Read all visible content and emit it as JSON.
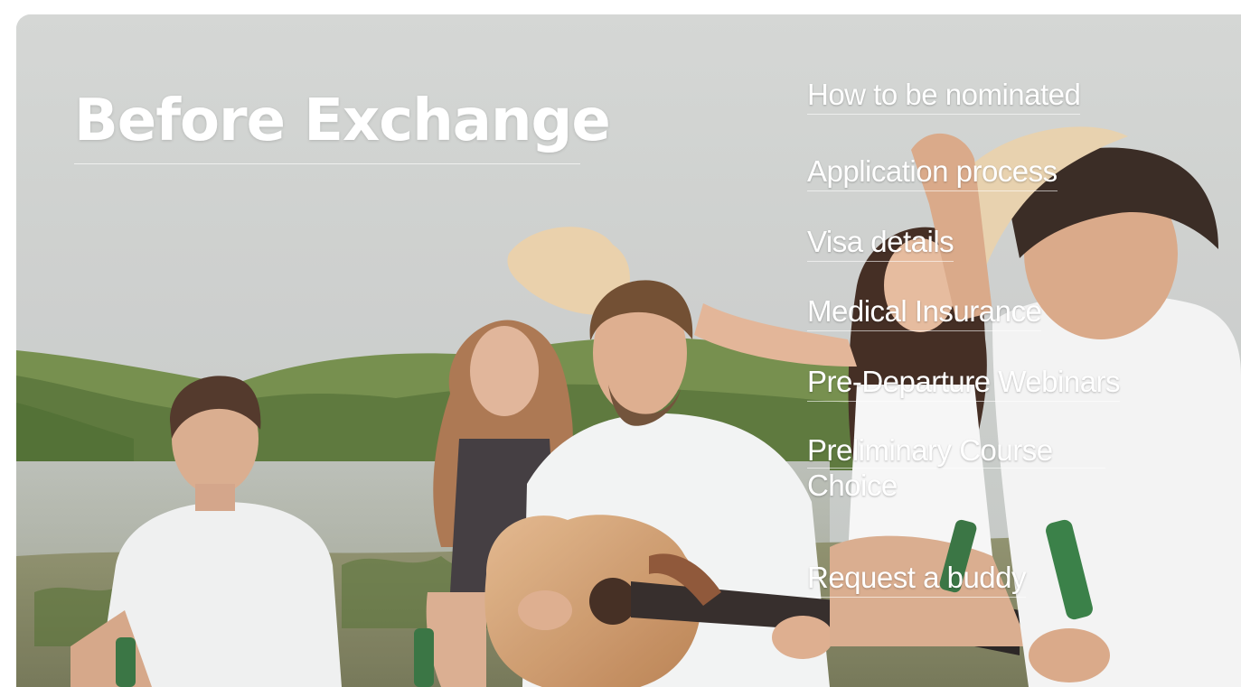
{
  "hero": {
    "title": "Before Exchange"
  },
  "nav": {
    "items": [
      {
        "label": "How to be nominated"
      },
      {
        "label": "Application process"
      },
      {
        "label": "Visa details"
      },
      {
        "label": "Medical Insurance"
      },
      {
        "label": "Pre-Departure Webinars"
      },
      {
        "label_line1": "Preliminary Course",
        "label_line2": "Choice"
      },
      {
        "label": "Request a buddy"
      }
    ]
  },
  "colors": {
    "title_text": "#ffffff",
    "link_text": "#ffffff",
    "sky": "#cfd3d0",
    "hills": "#5f7a3a",
    "water": "#b9beb8"
  }
}
